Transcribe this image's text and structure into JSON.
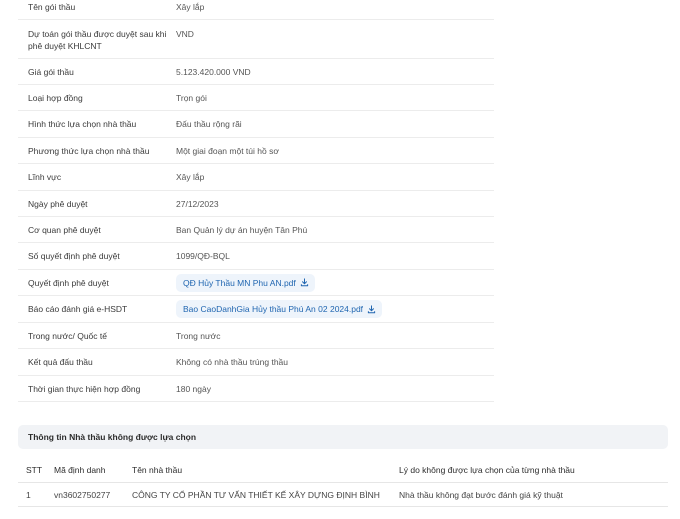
{
  "details": [
    {
      "label": "Tên gói thầu",
      "value": "Xây lắp"
    },
    {
      "label": "Dự toán gói thầu được duyệt sau khi phê duyệt KHLCNT",
      "value": "VND"
    },
    {
      "label": "Giá gói thầu",
      "value": "5.123.420.000 VND"
    },
    {
      "label": "Loại hợp đồng",
      "value": "Trọn gói"
    },
    {
      "label": "Hình thức lựa chọn nhà thầu",
      "value": "Đấu thầu rộng rãi"
    },
    {
      "label": "Phương thức lựa chọn nhà thầu",
      "value": "Một giai đoạn một túi hồ sơ"
    },
    {
      "label": "Lĩnh vực",
      "value": "Xây lắp"
    },
    {
      "label": "Ngày phê duyệt",
      "value": "27/12/2023"
    },
    {
      "label": "Cơ quan phê duyệt",
      "value": "Ban Quản lý dự án huyện Tân Phú"
    },
    {
      "label": "Số quyết định phê duyệt",
      "value": "1099/QĐ-BQL"
    },
    {
      "label": "Quyết định phê duyệt",
      "file": "QĐ Hủy Thầu MN Phu AN.pdf"
    },
    {
      "label": "Báo cáo đánh giá e-HSDT",
      "file": "Bao CaoDanhGia Hủy thầu Phú An 02 2024.pdf"
    },
    {
      "label": "Trong nước/ Quốc tế",
      "value": "Trong nước"
    },
    {
      "label": "Kết quả đấu thầu",
      "value": "Không có nhà thầu trúng thầu"
    },
    {
      "label": "Thời gian thực hiện hợp đồng",
      "value": "180 ngày"
    }
  ],
  "unselected_section": {
    "title": "Thông tin Nhà thầu không được lựa chọn",
    "columns": [
      "STT",
      "Mã định danh",
      "Tên nhà thầu",
      "Lý do không được lựa chọn của từng nhà thầu"
    ],
    "rows": [
      [
        "1",
        "vn3602750277",
        "CÔNG TY CỔ PHẦN TƯ VẤN THIẾT KẾ XÂY DỰNG ĐỊNH BÌNH",
        "Nhà thầu không đạt bước đánh giá kỹ thuật"
      ]
    ]
  },
  "colors": {
    "link_text": "#1f65b0",
    "link_bg": "#eef4fb",
    "section_bg": "#f1f3f6"
  },
  "icons": {
    "file_download": "download-icon"
  }
}
